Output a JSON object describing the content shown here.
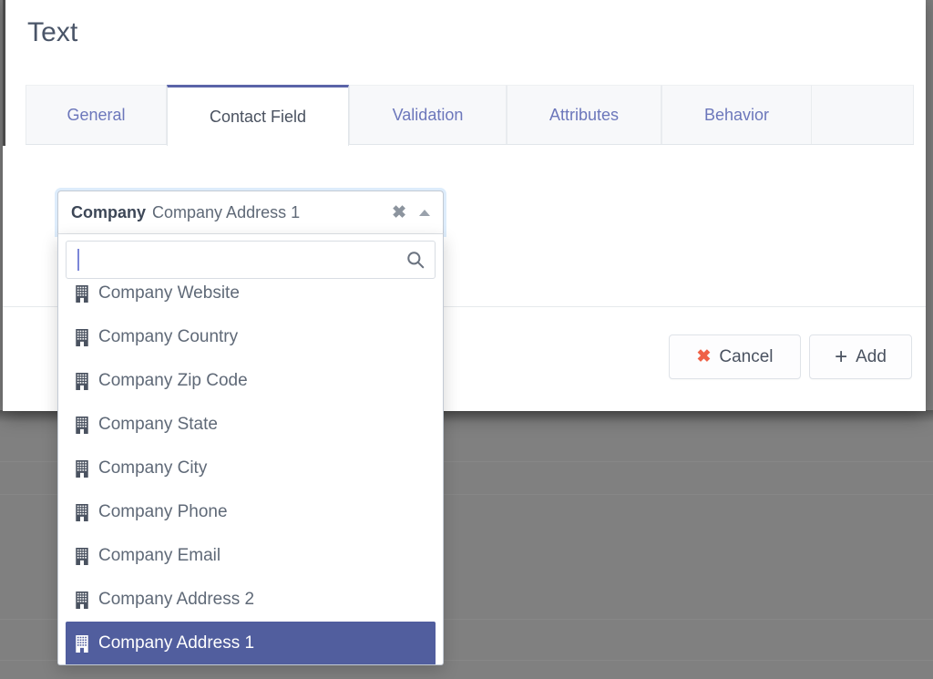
{
  "modal": {
    "title": "Text",
    "tabs": [
      {
        "label": "General",
        "active": false
      },
      {
        "label": "Contact Field",
        "active": true
      },
      {
        "label": "Validation",
        "active": false
      },
      {
        "label": "Attributes",
        "active": false
      },
      {
        "label": "Behavior",
        "active": false
      }
    ],
    "footer": {
      "cancel_label": "Cancel",
      "cancel_icon": "close-icon",
      "cancel_icon_glyph": "✖",
      "cancel_icon_color": "#ef6247",
      "add_label": "Add",
      "add_icon": "plus-icon",
      "add_icon_glyph": "＋",
      "add_icon_color": "#4a5260"
    }
  },
  "contact_field": {
    "select": {
      "group_label": "Company",
      "selected_value": "Company Address 1",
      "clear_icon": "clear-icon",
      "clear_glyph": "✖",
      "dropdown_arrow_icon": "caret-up-icon",
      "expanded": true
    },
    "search": {
      "value": "",
      "placeholder": "",
      "icon": "search-icon"
    },
    "options": [
      {
        "label": "Company Website",
        "icon": "building-icon",
        "selected": false,
        "clipped": true
      },
      {
        "label": "Company Country",
        "icon": "building-icon",
        "selected": false
      },
      {
        "label": "Company Zip Code",
        "icon": "building-icon",
        "selected": false
      },
      {
        "label": "Company State",
        "icon": "building-icon",
        "selected": false
      },
      {
        "label": "Company City",
        "icon": "building-icon",
        "selected": false
      },
      {
        "label": "Company Phone",
        "icon": "building-icon",
        "selected": false
      },
      {
        "label": "Company Email",
        "icon": "building-icon",
        "selected": false
      },
      {
        "label": "Company Address 2",
        "icon": "building-icon",
        "selected": false
      },
      {
        "label": "Company Address 1",
        "icon": "building-icon",
        "selected": true
      }
    ]
  },
  "colors": {
    "accent": "#5a64a8",
    "tab_link": "#6c77bb",
    "selected_row": "#515e9e",
    "cancel_icon": "#ef6247",
    "text": "#4a5260",
    "backdrop": "#808080"
  }
}
